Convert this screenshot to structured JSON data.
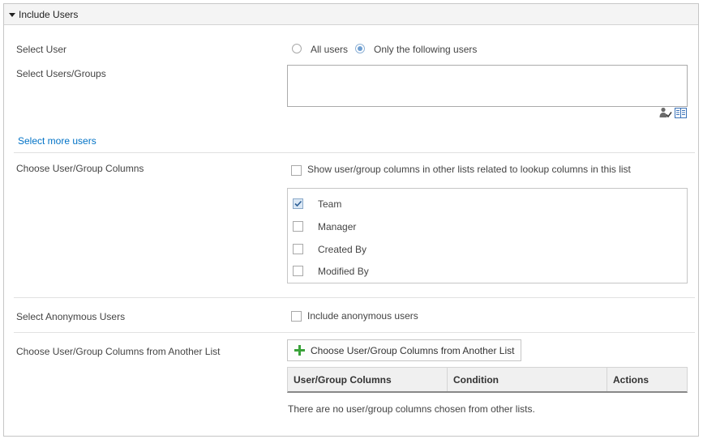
{
  "section": {
    "title": "Include Users"
  },
  "select_user": {
    "label": "Select User",
    "options": [
      {
        "label": "All users",
        "selected": false
      },
      {
        "label": "Only the following users",
        "selected": true
      }
    ]
  },
  "select_users_groups": {
    "label": "Select Users/Groups",
    "value": "",
    "icons": [
      "check-names-icon",
      "address-book-icon"
    ]
  },
  "select_more_users": {
    "label": "Select more users"
  },
  "user_group_columns": {
    "label": "Choose User/Group Columns",
    "show_related_label": "Show user/group columns in other lists related to lookup columns in this list",
    "show_related_checked": false,
    "columns": [
      {
        "label": "Team",
        "checked": true
      },
      {
        "label": "Manager",
        "checked": false
      },
      {
        "label": "Created By",
        "checked": false
      },
      {
        "label": "Modified By",
        "checked": false
      }
    ]
  },
  "anonymous": {
    "label": "Select Anonymous Users",
    "checkbox_label": "Include anonymous users",
    "checked": false
  },
  "another_list": {
    "label": "Choose User/Group Columns from Another List",
    "button_label": "Choose User/Group Columns from Another List",
    "table_headers": [
      "User/Group Columns",
      "Condition",
      "Actions"
    ],
    "empty_message": "There are no user/group columns chosen from other lists."
  },
  "colors": {
    "link": "#0072c6",
    "accent_green": "#3aa23a",
    "radio_selected": "#6f9fd1"
  }
}
